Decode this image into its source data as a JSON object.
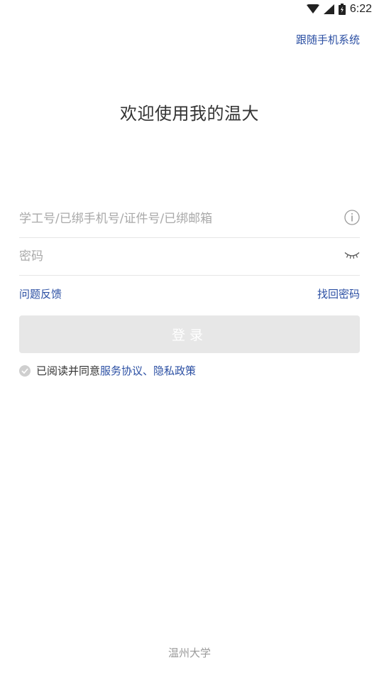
{
  "status_bar": {
    "time": "6:22",
    "icons": [
      "wifi-icon",
      "signal-icon",
      "battery-icon"
    ]
  },
  "header": {
    "follow_system_label": "跟随手机系统"
  },
  "welcome": {
    "title": "欢迎使用我的温大"
  },
  "form": {
    "account_placeholder": "学工号/已绑手机号/证件号/已绑邮箱",
    "account_value": "",
    "account_icon": "info-icon",
    "password_placeholder": "密码",
    "password_value": "",
    "password_icon": "eye-closed-icon",
    "feedback_label": "问题反馈",
    "forgot_password_label": "找回密码",
    "login_label": "登录"
  },
  "agreement": {
    "prefix": "已阅读并同意",
    "link": "服务协议、隐私政策",
    "checked": false
  },
  "footer": {
    "text": "温州大学"
  },
  "colors": {
    "accent": "#2b4fa3",
    "button_disabled": "#e7e7e7",
    "placeholder": "#a9a9a9",
    "divider": "#e6e6e6"
  }
}
